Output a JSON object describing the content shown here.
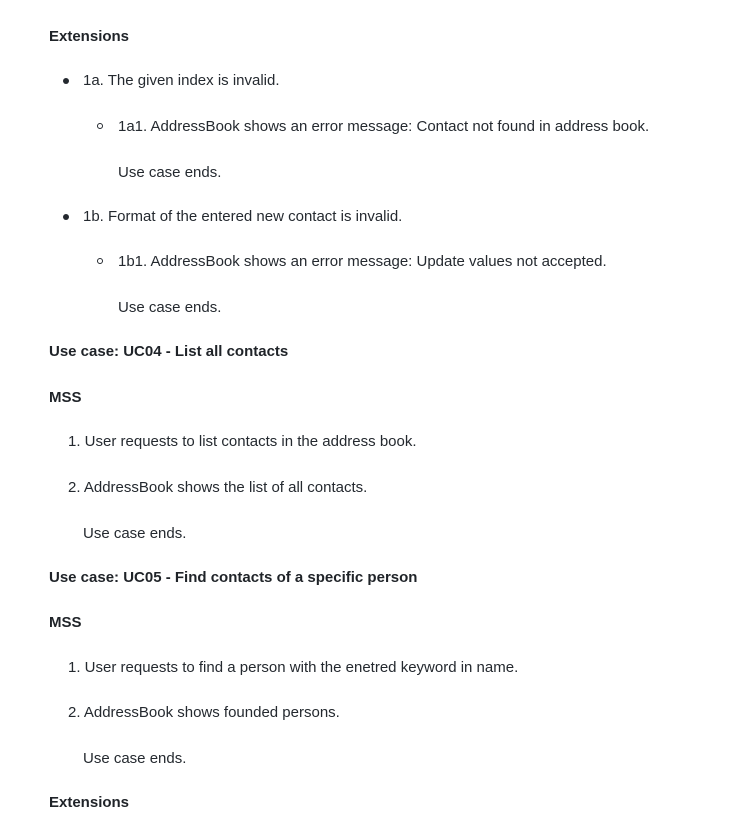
{
  "section_extensions_1": {
    "heading": "Extensions",
    "items": [
      {
        "text": "1a. The given index is invalid.",
        "sub": "1a1. AddressBook shows an error message: Contact not found in address book.",
        "note": "Use case ends."
      },
      {
        "text": "1b. Format of the entered new contact is invalid.",
        "sub": "1b1. AddressBook shows an error message: Update values not accepted.",
        "note": "Use case ends."
      }
    ]
  },
  "uc04": {
    "title": "Use case: UC04 - List all contacts",
    "mss_heading": "MSS",
    "steps": [
      "1. User requests to list contacts in the address book.",
      "2. AddressBook shows the list of all contacts."
    ],
    "end": "Use case ends."
  },
  "uc05": {
    "title": "Use case: UC05 - Find contacts of a specific person",
    "mss_heading": "MSS",
    "steps": [
      "1. User requests to find a person with the enetred keyword in name.",
      "2. AddressBook shows founded persons."
    ],
    "end": "Use case ends.",
    "extensions_heading": "Extensions"
  }
}
